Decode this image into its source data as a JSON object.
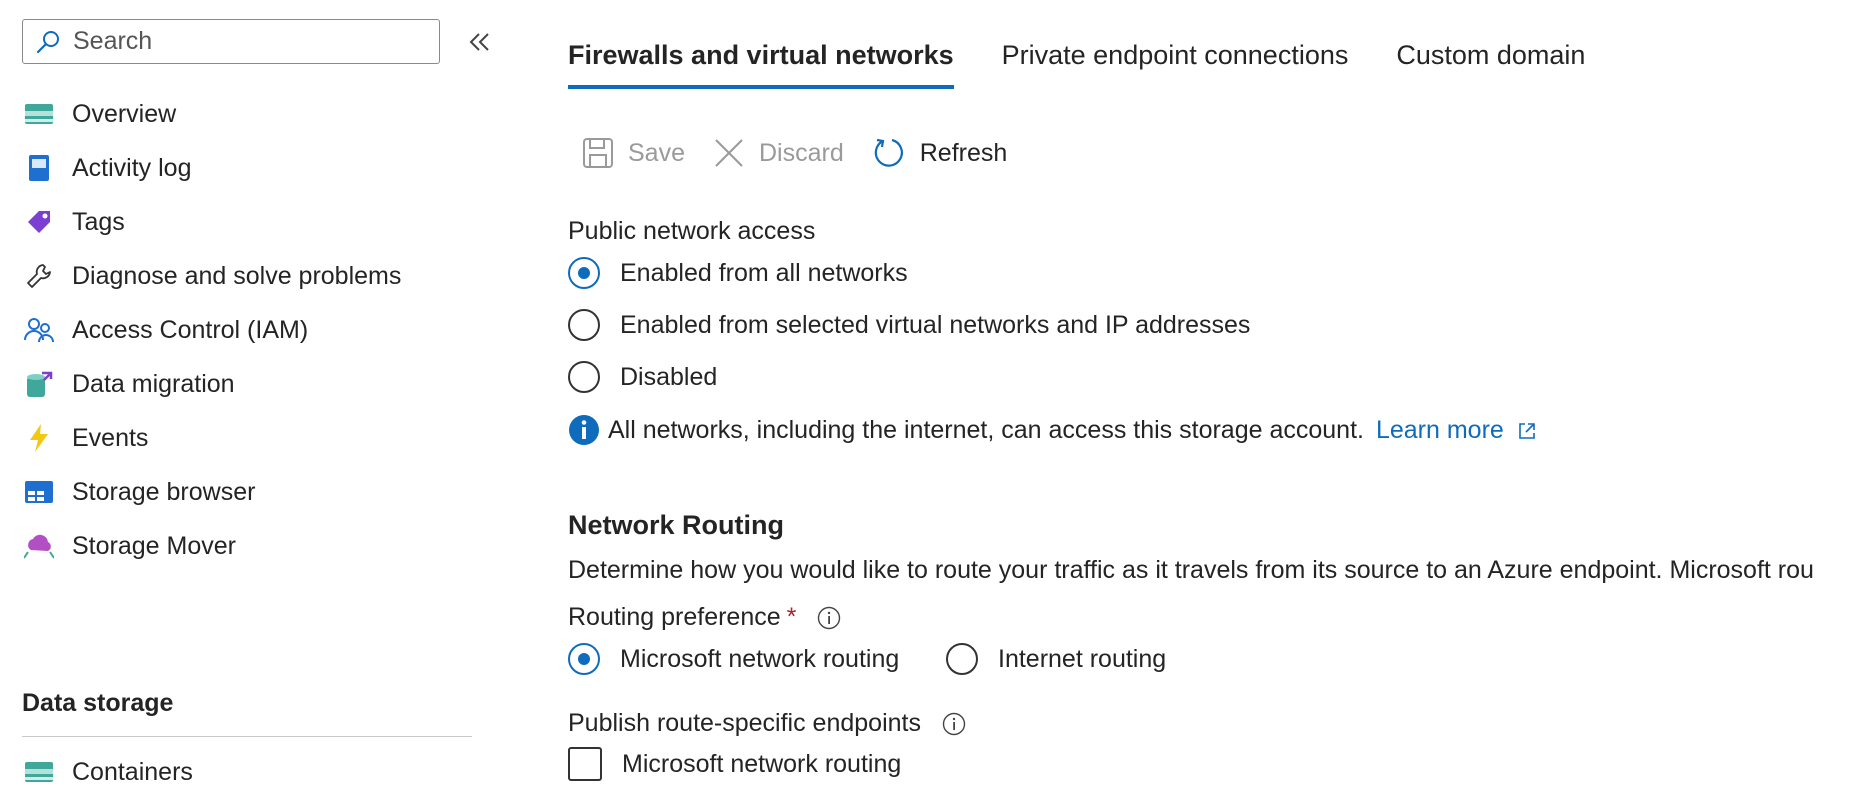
{
  "sidebar": {
    "search": {
      "placeholder": "Search"
    },
    "items": [
      {
        "label": "Overview",
        "icon": "overview-icon"
      },
      {
        "label": "Activity log",
        "icon": "activity-log-icon"
      },
      {
        "label": "Tags",
        "icon": "tag-icon"
      },
      {
        "label": "Diagnose and solve problems",
        "icon": "wrench-icon"
      },
      {
        "label": "Access Control (IAM)",
        "icon": "people-icon"
      },
      {
        "label": "Data migration",
        "icon": "data-migration-icon"
      },
      {
        "label": "Events",
        "icon": "lightning-icon"
      },
      {
        "label": "Storage browser",
        "icon": "storage-browser-icon"
      },
      {
        "label": "Storage Mover",
        "icon": "cloud-icon"
      }
    ],
    "section": {
      "title": "Data storage",
      "items": [
        {
          "label": "Containers",
          "icon": "containers-icon"
        }
      ]
    }
  },
  "tabs": [
    {
      "label": "Firewalls and virtual networks",
      "active": true
    },
    {
      "label": "Private endpoint connections",
      "active": false
    },
    {
      "label": "Custom domain",
      "active": false
    }
  ],
  "toolbar": {
    "save": "Save",
    "discard": "Discard",
    "refresh": "Refresh"
  },
  "public_access": {
    "label": "Public network access",
    "options": [
      {
        "label": "Enabled from all networks",
        "selected": true
      },
      {
        "label": "Enabled from selected virtual networks and IP addresses",
        "selected": false
      },
      {
        "label": "Disabled",
        "selected": false
      }
    ],
    "info": "All networks, including the internet, can access this storage account.",
    "learn_more": "Learn more"
  },
  "routing": {
    "heading": "Network Routing",
    "description": "Determine how you would like to route your traffic as it travels from its source to an Azure endpoint. Microsoft rou",
    "preference_label": "Routing preference",
    "required_mark": "*",
    "options": [
      {
        "label": "Microsoft network routing",
        "selected": true
      },
      {
        "label": "Internet routing",
        "selected": false
      }
    ],
    "publish_label": "Publish route-specific endpoints",
    "publish_options": [
      {
        "label": "Microsoft network routing",
        "checked": false
      }
    ]
  },
  "colors": {
    "accent": "#0f6cbd",
    "required": "#a4262c",
    "text": "#242424",
    "disabled": "#9a9a9a"
  }
}
